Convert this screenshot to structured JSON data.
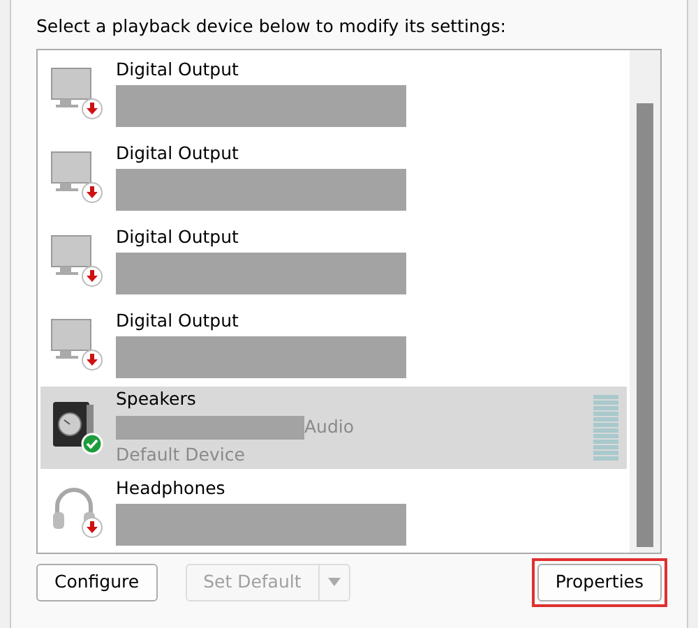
{
  "instruction": "Select a playback device below to modify its settings:",
  "devices": [
    {
      "name": "Digital Output",
      "kind": "monitor",
      "default": false,
      "selected": false
    },
    {
      "name": "Digital Output",
      "kind": "monitor",
      "default": false,
      "selected": false
    },
    {
      "name": "Digital Output",
      "kind": "monitor",
      "default": false,
      "selected": false
    },
    {
      "name": "Digital Output",
      "kind": "monitor",
      "default": false,
      "selected": false
    },
    {
      "name": "Speakers",
      "kind": "speaker",
      "default": true,
      "selected": true,
      "description": "Audio",
      "state_text": "Default Device",
      "level": 0
    },
    {
      "name": "Headphones",
      "kind": "headphones",
      "default": false,
      "selected": false
    }
  ],
  "buttons": [
    {
      "label": "Configure",
      "disabled": false,
      "split": false,
      "highlighted": false
    },
    {
      "label": "Set Default",
      "disabled": true,
      "split": true,
      "highlighted": false
    },
    {
      "label": "Properties",
      "disabled": false,
      "split": false,
      "highlighted": true
    }
  ]
}
